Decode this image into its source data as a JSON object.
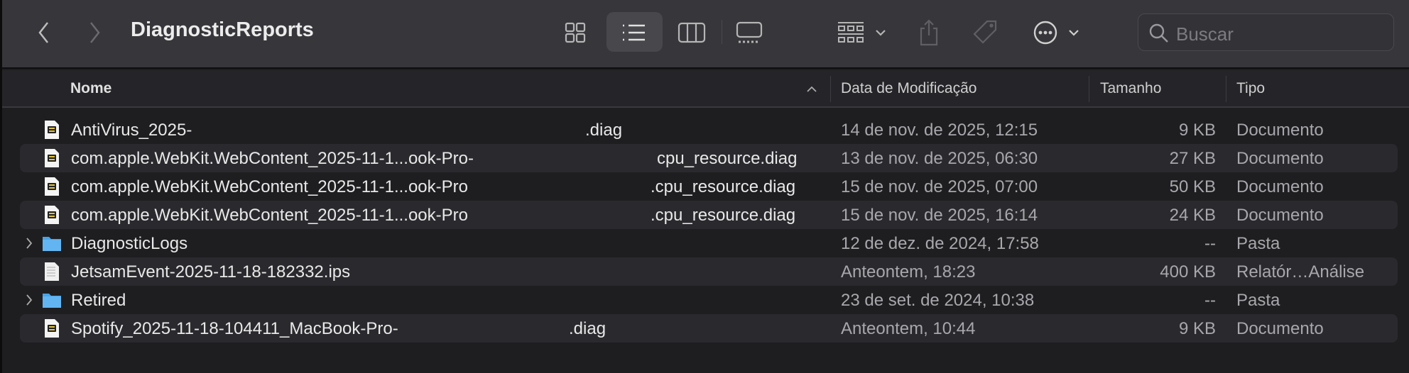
{
  "toolbar": {
    "title": "DiagnosticReports",
    "search_placeholder": "Buscar"
  },
  "columns": {
    "name": "Nome",
    "date": "Data de Modificação",
    "size": "Tamanho",
    "type": "Tipo"
  },
  "rows": [
    {
      "icon": "diag",
      "name": "AntiVirus_2025-",
      "suffix": ".diag",
      "date": "14 de nov. de 2025, 12:15",
      "size": "9 KB",
      "type": "Documento",
      "folder": false
    },
    {
      "icon": "diag",
      "name": "com.apple.WebKit.WebContent_2025-11-1...ook-Pro-",
      "suffix": "cpu_resource.diag",
      "date": "13 de nov. de 2025, 06:30",
      "size": "27 KB",
      "type": "Documento",
      "folder": false
    },
    {
      "icon": "diag",
      "name": "com.apple.WebKit.WebContent_2025-11-1...ook-Pro",
      "suffix": ".cpu_resource.diag",
      "date": "15 de nov. de 2025, 07:00",
      "size": "50 KB",
      "type": "Documento",
      "folder": false
    },
    {
      "icon": "diag",
      "name": "com.apple.WebKit.WebContent_2025-11-1...ook-Pro",
      "suffix": ".cpu_resource.diag",
      "date": "15 de nov. de 2025, 16:14",
      "size": "24 KB",
      "type": "Documento",
      "folder": false
    },
    {
      "icon": "folder",
      "name": "DiagnosticLogs",
      "suffix": "",
      "date": "12 de dez. de 2024, 17:58",
      "size": "--",
      "type": "Pasta",
      "folder": true
    },
    {
      "icon": "text",
      "name": "JetsamEvent-2025-11-18-182332.ips",
      "suffix": "",
      "date": "Anteontem, 18:23",
      "size": "400 KB",
      "type": "Relatór…Análise",
      "folder": false
    },
    {
      "icon": "folder",
      "name": "Retired",
      "suffix": "",
      "date": "23 de set. de 2024, 10:38",
      "size": "--",
      "type": "Pasta",
      "folder": true
    },
    {
      "icon": "diag",
      "name": "Spotify_2025-11-18-104411_MacBook-Pro-",
      "suffix": ".diag",
      "date": "Anteontem, 10:44",
      "size": "9 KB",
      "type": "Documento",
      "folder": false
    }
  ]
}
